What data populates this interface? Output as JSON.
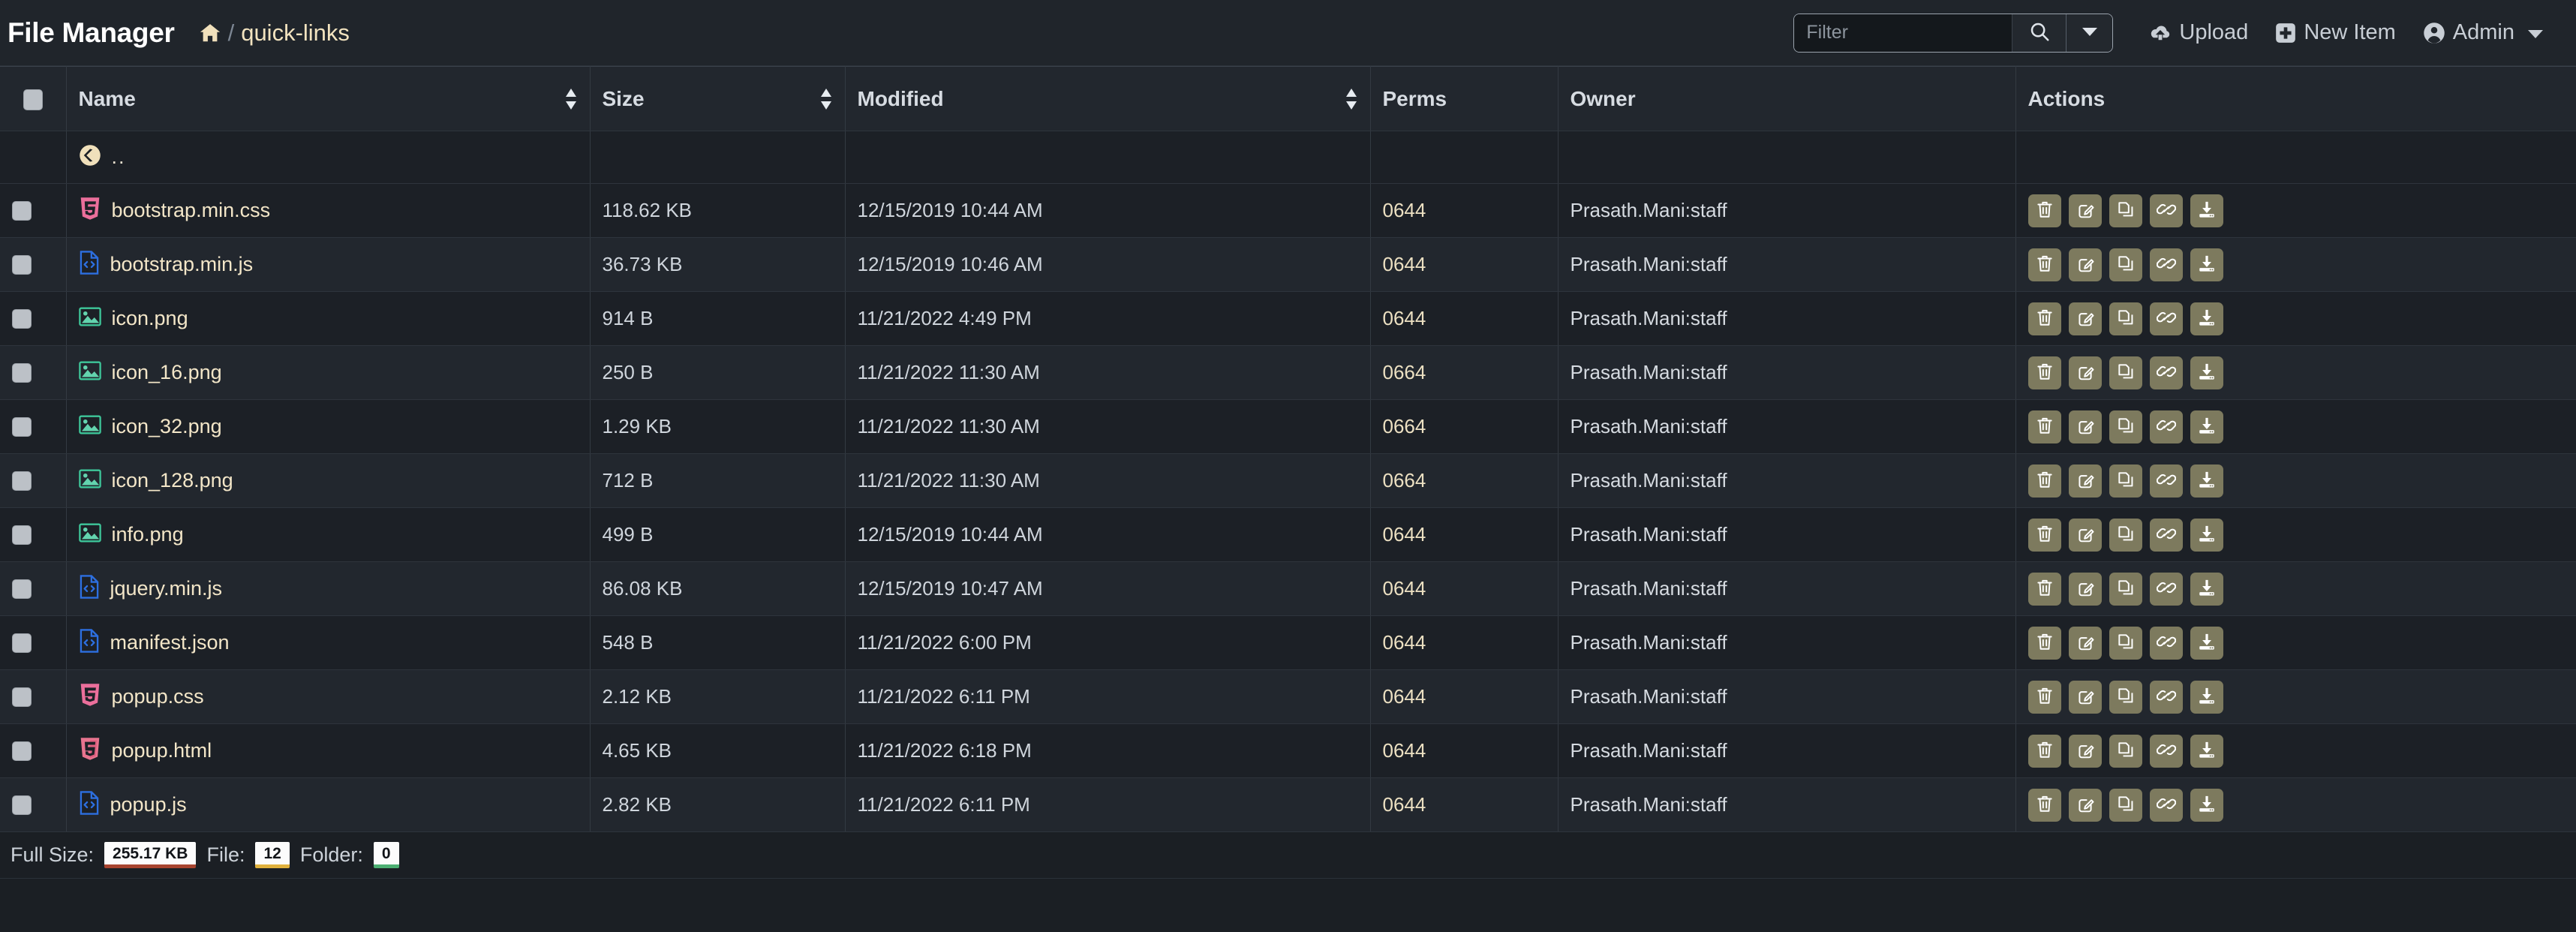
{
  "header": {
    "brand": "File Manager",
    "breadcrumb": {
      "home_icon": "home-icon",
      "separator": "/",
      "path": "quick-links"
    },
    "search": {
      "placeholder": "Filter",
      "value": "",
      "search_icon": "search-icon",
      "caret_icon": "caret-down-icon"
    },
    "buttons": [
      {
        "label": "Upload",
        "icon": "cloud-upload-icon"
      },
      {
        "label": "New Item",
        "icon": "plus-square-icon"
      },
      {
        "label": "Admin",
        "icon": "user-circle-icon",
        "caret": "caret-down-icon"
      }
    ]
  },
  "table": {
    "columns": [
      {
        "key": "check",
        "label": "",
        "sortable": false
      },
      {
        "key": "name",
        "label": "Name",
        "sortable": true
      },
      {
        "key": "size",
        "label": "Size",
        "sortable": true
      },
      {
        "key": "modified",
        "label": "Modified",
        "sortable": true
      },
      {
        "key": "perms",
        "label": "Perms",
        "sortable": false
      },
      {
        "key": "owner",
        "label": "Owner",
        "sortable": false
      },
      {
        "key": "actions",
        "label": "Actions",
        "sortable": false
      }
    ],
    "parent_row": {
      "name": "..",
      "icon": "back-circle-icon"
    },
    "rows": [
      {
        "name": "bootstrap.min.css",
        "icon": "css3-file-icon",
        "size": "118.62 KB",
        "modified": "12/15/2019 10:44 AM",
        "perms": "0644",
        "owner": "Prasath.Mani:staff"
      },
      {
        "name": "bootstrap.min.js",
        "icon": "code-file-icon",
        "size": "36.73 KB",
        "modified": "12/15/2019 10:46 AM",
        "perms": "0644",
        "owner": "Prasath.Mani:staff"
      },
      {
        "name": "icon.png",
        "icon": "image-file-icon",
        "size": "914 B",
        "modified": "11/21/2022 4:49 PM",
        "perms": "0644",
        "owner": "Prasath.Mani:staff"
      },
      {
        "name": "icon_16.png",
        "icon": "image-file-icon",
        "size": "250 B",
        "modified": "11/21/2022 11:30 AM",
        "perms": "0664",
        "owner": "Prasath.Mani:staff"
      },
      {
        "name": "icon_32.png",
        "icon": "image-file-icon",
        "size": "1.29 KB",
        "modified": "11/21/2022 11:30 AM",
        "perms": "0664",
        "owner": "Prasath.Mani:staff"
      },
      {
        "name": "icon_128.png",
        "icon": "image-file-icon",
        "size": "712 B",
        "modified": "11/21/2022 11:30 AM",
        "perms": "0664",
        "owner": "Prasath.Mani:staff"
      },
      {
        "name": "info.png",
        "icon": "image-file-icon",
        "size": "499 B",
        "modified": "12/15/2019 10:44 AM",
        "perms": "0644",
        "owner": "Prasath.Mani:staff"
      },
      {
        "name": "jquery.min.js",
        "icon": "code-file-icon",
        "size": "86.08 KB",
        "modified": "12/15/2019 10:47 AM",
        "perms": "0644",
        "owner": "Prasath.Mani:staff"
      },
      {
        "name": "manifest.json",
        "icon": "code-file-icon",
        "size": "548 B",
        "modified": "11/21/2022 6:00 PM",
        "perms": "0644",
        "owner": "Prasath.Mani:staff"
      },
      {
        "name": "popup.css",
        "icon": "css3-file-icon",
        "size": "2.12 KB",
        "modified": "11/21/2022 6:11 PM",
        "perms": "0644",
        "owner": "Prasath.Mani:staff"
      },
      {
        "name": "popup.html",
        "icon": "html5-file-icon",
        "size": "4.65 KB",
        "modified": "11/21/2022 6:18 PM",
        "perms": "0644",
        "owner": "Prasath.Mani:staff"
      },
      {
        "name": "popup.js",
        "icon": "code-file-icon",
        "size": "2.82 KB",
        "modified": "11/21/2022 6:11 PM",
        "perms": "0644",
        "owner": "Prasath.Mani:staff"
      }
    ],
    "row_actions": [
      {
        "name": "delete",
        "icon": "trash-icon"
      },
      {
        "name": "rename",
        "icon": "edit-pencil-icon"
      },
      {
        "name": "copy",
        "icon": "copy-icon"
      },
      {
        "name": "link",
        "icon": "chain-link-icon"
      },
      {
        "name": "download",
        "icon": "download-icon"
      }
    ]
  },
  "footer": {
    "full_size_label": "Full Size:",
    "full_size_value": "255.17 KB",
    "file_label": "File:",
    "file_value": "12",
    "folder_label": "Folder:",
    "folder_value": "0"
  },
  "colors": {
    "page_bg": "#1b1f24",
    "bar_bg": "#20252b",
    "row_odd": "#1c2026",
    "row_even": "#22272e",
    "filename": "#f3e6c8",
    "action_btn": "#7d7a5e",
    "badge_red": "#a8442f",
    "badge_yellow": "#e0b13c",
    "badge_green": "#4caf72"
  }
}
